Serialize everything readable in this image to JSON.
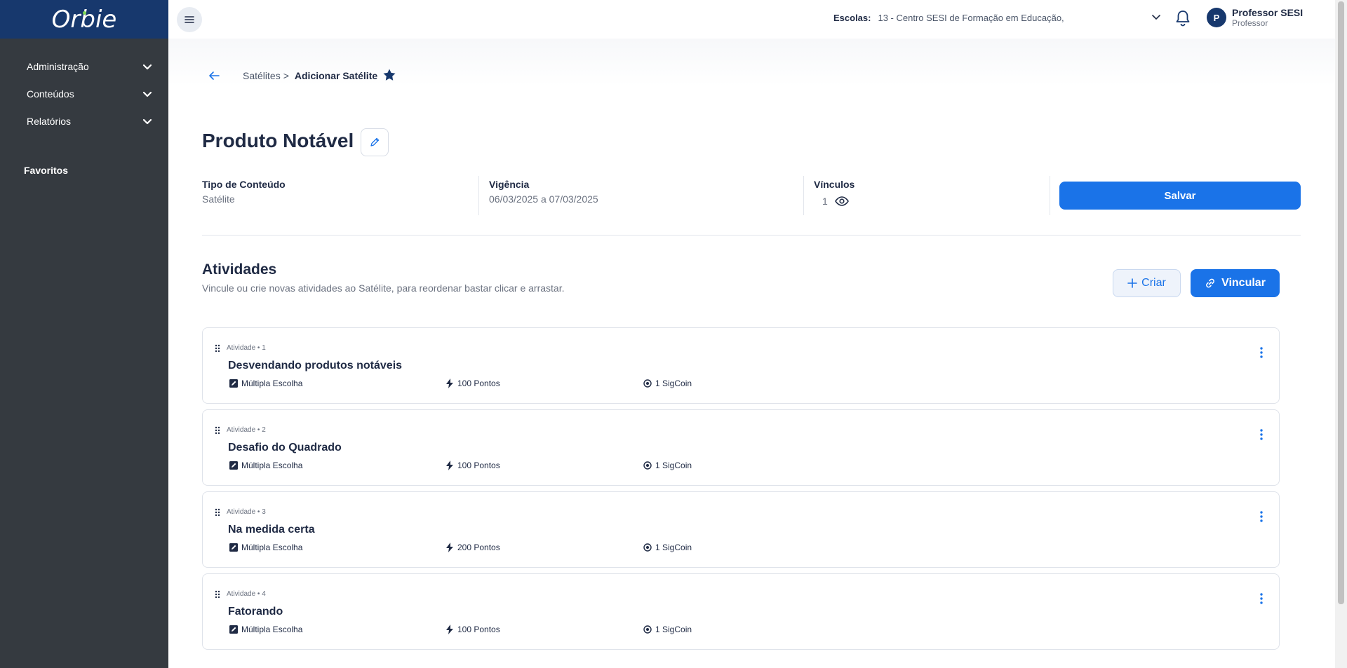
{
  "app": {
    "logo_text": "Orbie"
  },
  "sidebar": {
    "items": [
      {
        "label": "Administração"
      },
      {
        "label": "Conteúdos"
      },
      {
        "label": "Relatórios"
      }
    ],
    "favorites_title": "Favoritos"
  },
  "topbar": {
    "schools_label": "Escolas:",
    "schools_value": "13 - Centro SESI de Formação em Educação,",
    "user_initial": "P",
    "user_name": "Professor SESI",
    "user_role": "Professor"
  },
  "breadcrumb": {
    "parent": "Satélites",
    "separator": ">",
    "current": "Adicionar Satélite"
  },
  "page": {
    "title": "Produto Notável"
  },
  "info": {
    "type_label": "Tipo de Conteúdo",
    "type_value": "Satélite",
    "validity_label": "Vigência",
    "validity_value": "06/03/2025 a 07/03/2025",
    "links_label": "Vínculos",
    "links_value": "1",
    "save_label": "Salvar"
  },
  "activities": {
    "title": "Atividades",
    "subtitle": "Vincule ou crie novas atividades ao Satélite, para reordenar bastar clicar e arrastar.",
    "create_label": "Criar",
    "link_label": "Vincular",
    "items": [
      {
        "meta": "Atividade  •  1",
        "title": "Desvendando produtos notáveis",
        "type": "Múltipla Escolha",
        "points": "100 Pontos",
        "coins": "1 SigCoin"
      },
      {
        "meta": "Atividade  •  2",
        "title": "Desafio do Quadrado",
        "type": "Múltipla Escolha",
        "points": "100 Pontos",
        "coins": "1 SigCoin"
      },
      {
        "meta": "Atividade  •  3",
        "title": "Na medida certa",
        "type": "Múltipla Escolha",
        "points": "200 Pontos",
        "coins": "1 SigCoin"
      },
      {
        "meta": "Atividade  •  4",
        "title": "Fatorando",
        "type": "Múltipla Escolha",
        "points": "100 Pontos",
        "coins": "1 SigCoin"
      }
    ]
  },
  "colors": {
    "primary": "#1a73e8",
    "sidebar": "#353a40",
    "logo_bar": "#17386d"
  }
}
